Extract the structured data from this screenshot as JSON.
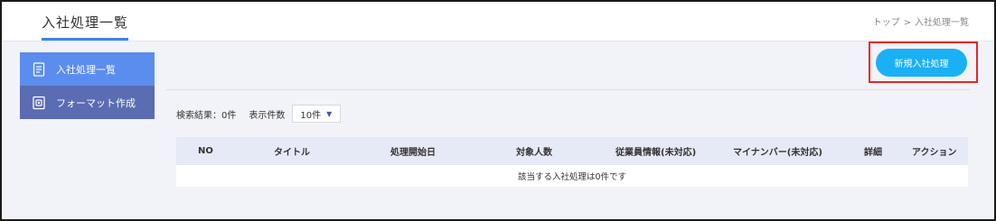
{
  "header": {
    "title": "入社処理一覧",
    "breadcrumb": [
      "トップ",
      "入社処理一覧"
    ],
    "breadcrumb_separator": ">"
  },
  "sidebar": {
    "items": [
      {
        "label": "入社処理一覧",
        "icon": "document-list-icon",
        "active": true
      },
      {
        "label": "フォーマット作成",
        "icon": "format-template-icon",
        "active": false
      }
    ]
  },
  "toolbar": {
    "new_button_label": "新規入社処理"
  },
  "search": {
    "result_label": "検索結果：0件",
    "per_page_label": "表示件数",
    "per_page_value": "10件"
  },
  "table": {
    "columns": [
      "NO",
      "タイトル",
      "処理開始日",
      "対象人数",
      "従業員情報(未対応)",
      "マイナンバー(未対応)",
      "詳細",
      "アクション"
    ],
    "empty_message": "該当する入社処理は0件です"
  },
  "colors": {
    "accent": "#1ab0f5",
    "sidebar_active": "#5b8def",
    "sidebar_inactive": "#5a6cb2",
    "highlight": "#e8242a",
    "table_header": "#e6e9f6"
  }
}
